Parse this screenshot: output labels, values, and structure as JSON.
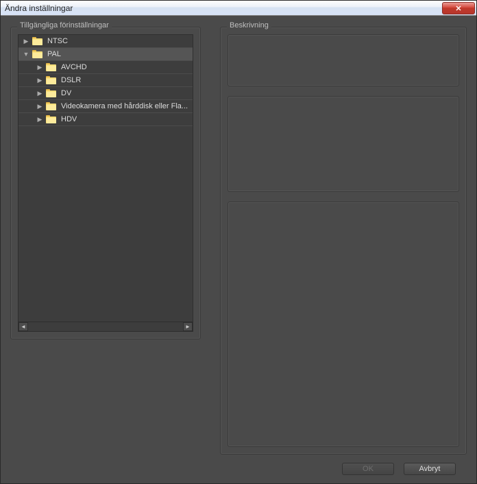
{
  "window": {
    "title": "Ändra inställningar"
  },
  "panels": {
    "presets_label": "Tillgängliga förinställningar",
    "description_label": "Beskrivning"
  },
  "tree": {
    "items": [
      {
        "label": "NTSC",
        "depth": 0,
        "expanded": false,
        "selected": false
      },
      {
        "label": "PAL",
        "depth": 0,
        "expanded": true,
        "selected": true
      },
      {
        "label": "AVCHD",
        "depth": 1,
        "expanded": false,
        "selected": false
      },
      {
        "label": "DSLR",
        "depth": 1,
        "expanded": false,
        "selected": false
      },
      {
        "label": "DV",
        "depth": 1,
        "expanded": false,
        "selected": false
      },
      {
        "label": "Videokamera med hårddisk eller Fla...",
        "depth": 1,
        "expanded": false,
        "selected": false
      },
      {
        "label": "HDV",
        "depth": 1,
        "expanded": false,
        "selected": false
      }
    ]
  },
  "buttons": {
    "ok": "OK",
    "cancel": "Avbryt"
  }
}
